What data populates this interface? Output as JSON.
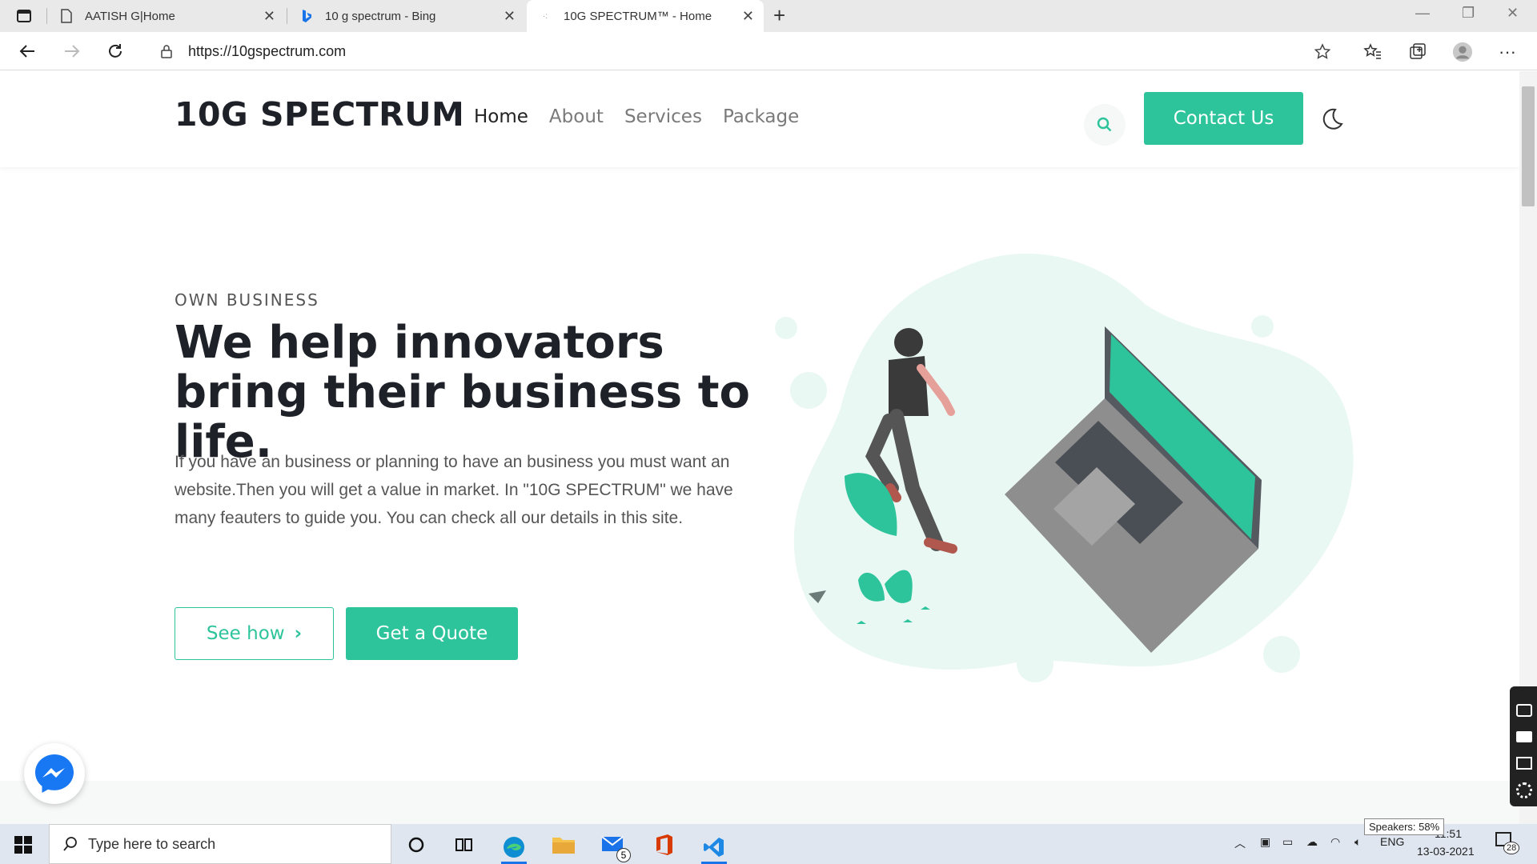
{
  "browser": {
    "tabs": [
      {
        "title": "AATISH G|Home"
      },
      {
        "title": "10 g spectrum - Bing"
      },
      {
        "title": "10G SPECTRUM™ - Home"
      }
    ],
    "url": "https://10gspectrum.com"
  },
  "site": {
    "logo": "10G SPECTRUM",
    "nav": [
      "Home",
      "About",
      "Services",
      "Package"
    ],
    "contact_label": "Contact Us",
    "hero": {
      "eyebrow": "OWN BUSINESS",
      "title": "We help innovators bring their business to life.",
      "text": "If you have an business or planning to have an business you must want an website.Then you will get a value in market. In \"10G SPECTRUM\" we have many feauters to guide you. You can check all our details in this site.",
      "see_how": "See how",
      "quote": "Get a Quote"
    },
    "accent": "#2ec49b"
  },
  "taskbar": {
    "search_placeholder": "Type here to search",
    "mail_badge": "5",
    "lang": "ENG",
    "time": "11:51",
    "date": "13-03-2021",
    "notif_count": "28",
    "speaker_tooltip": "Speakers: 58%"
  }
}
